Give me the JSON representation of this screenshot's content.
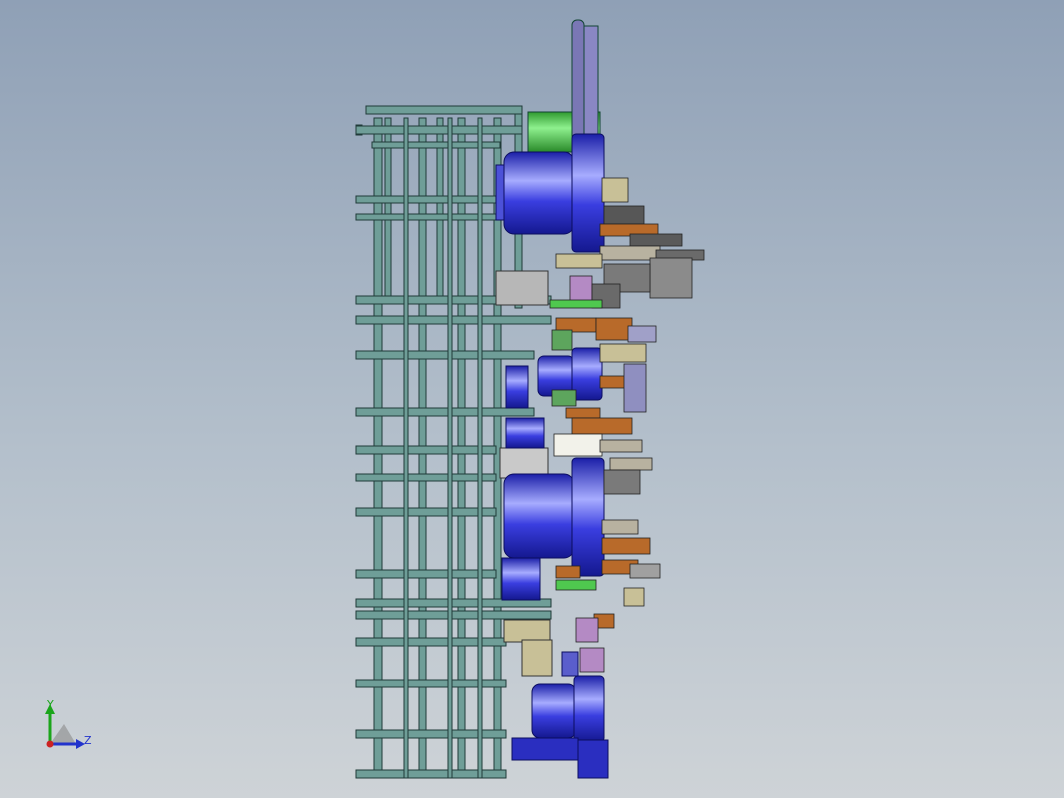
{
  "viewport": {
    "background_top": "#8fa0b6",
    "background_bottom": "#ced3d7"
  },
  "model": {
    "frame_color": "#6f9e98",
    "frame_edge": "#1f3a38",
    "roller_color": "#3b3fd6",
    "roller_highlight": "#9aa0ff",
    "accent_green": "#4fc84f",
    "accent_orange": "#b86a2a",
    "accent_grey": "#b8b2a0"
  },
  "triad": {
    "y_label": "Y",
    "z_label": "Z",
    "y_color": "#1aa51a",
    "z_color": "#2233cc",
    "origin_color": "#cc2222"
  }
}
